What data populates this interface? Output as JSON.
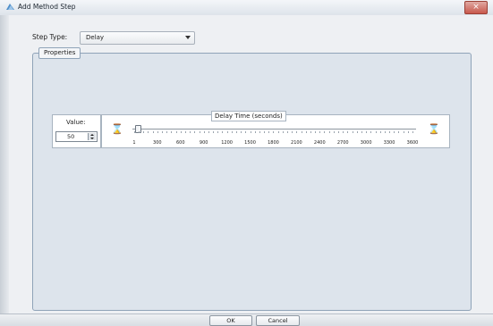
{
  "window": {
    "title": "Add Method Step",
    "close_glyph": "×"
  },
  "step_type": {
    "label": "Step Type:",
    "selected": "Delay"
  },
  "properties": {
    "legend": "Properties",
    "value": {
      "label": "Value:",
      "current": "50"
    },
    "slider": {
      "title": "Delay Time (seconds)",
      "ticks": [
        "1",
        "300",
        "600",
        "900",
        "1200",
        "1500",
        "1800",
        "2100",
        "2400",
        "2700",
        "3000",
        "3300",
        "3600"
      ],
      "min": 1,
      "max": 3600,
      "current": 50,
      "left_icon": "hourglass-icon",
      "right_icon": "hourglass-icon",
      "hourglass_glyph": "⌛"
    }
  },
  "buttons": {
    "ok": "OK",
    "cancel": "Cancel"
  },
  "colors": {
    "panel_bg": "#dde4ec",
    "border": "#8fa3b8",
    "close_red": "#c8584c"
  }
}
